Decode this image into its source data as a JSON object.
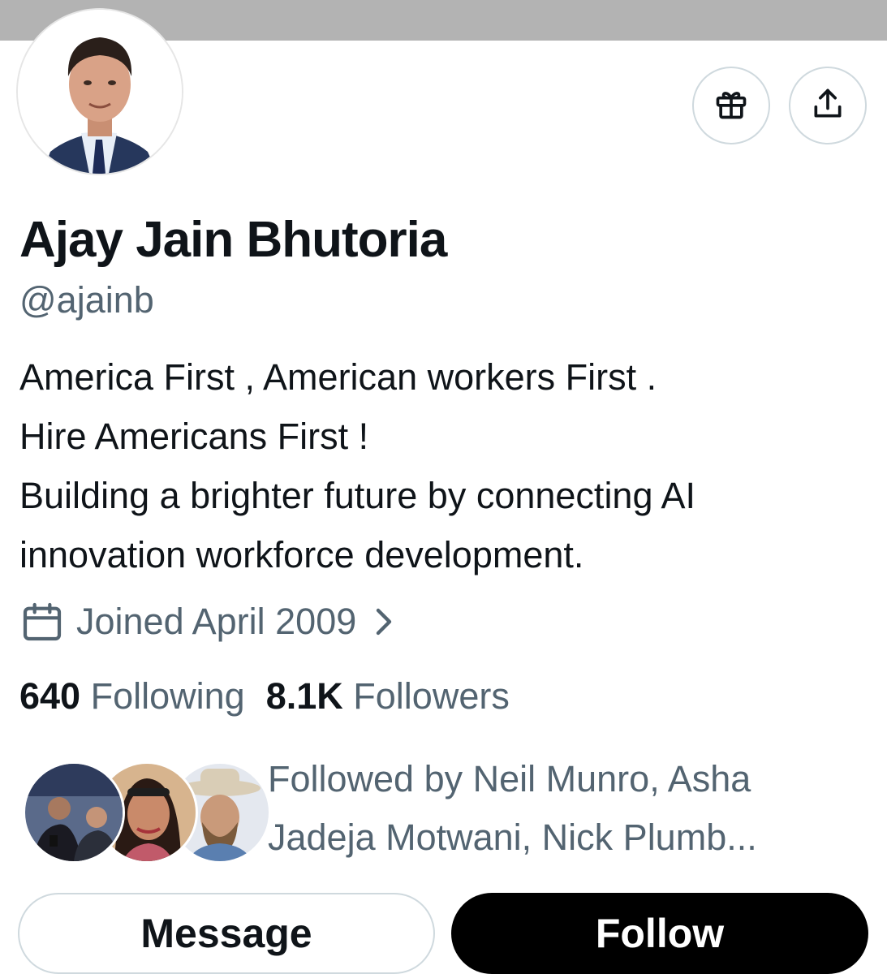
{
  "profile": {
    "name": "Ajay Jain Bhutoria",
    "handle": "@ajainb",
    "bio_lines": [
      "America First , American workers First .",
      "Hire Americans First !",
      "Building a brighter future by connecting AI",
      "innovation workforce development."
    ],
    "joined": "Joined April 2009"
  },
  "stats": {
    "following_count": "640",
    "following_label": "Following",
    "followers_count": "8.1K",
    "followers_label": "Followers"
  },
  "followed_by": {
    "text": "Followed by Neil Munro, Asha Jadeja Motwani, Nick Plumb..."
  },
  "actions": {
    "message_label": "Message",
    "follow_label": "Follow"
  },
  "icons": {
    "gift": "gift-icon",
    "share": "share-icon",
    "calendar": "calendar-icon",
    "chevron": "chevron-right-icon"
  },
  "colors": {
    "primary_text": "#0f1419",
    "secondary_text": "#536471",
    "border": "#cfd9de",
    "follow_button": "#000000",
    "banner": "#b3b3b3"
  }
}
